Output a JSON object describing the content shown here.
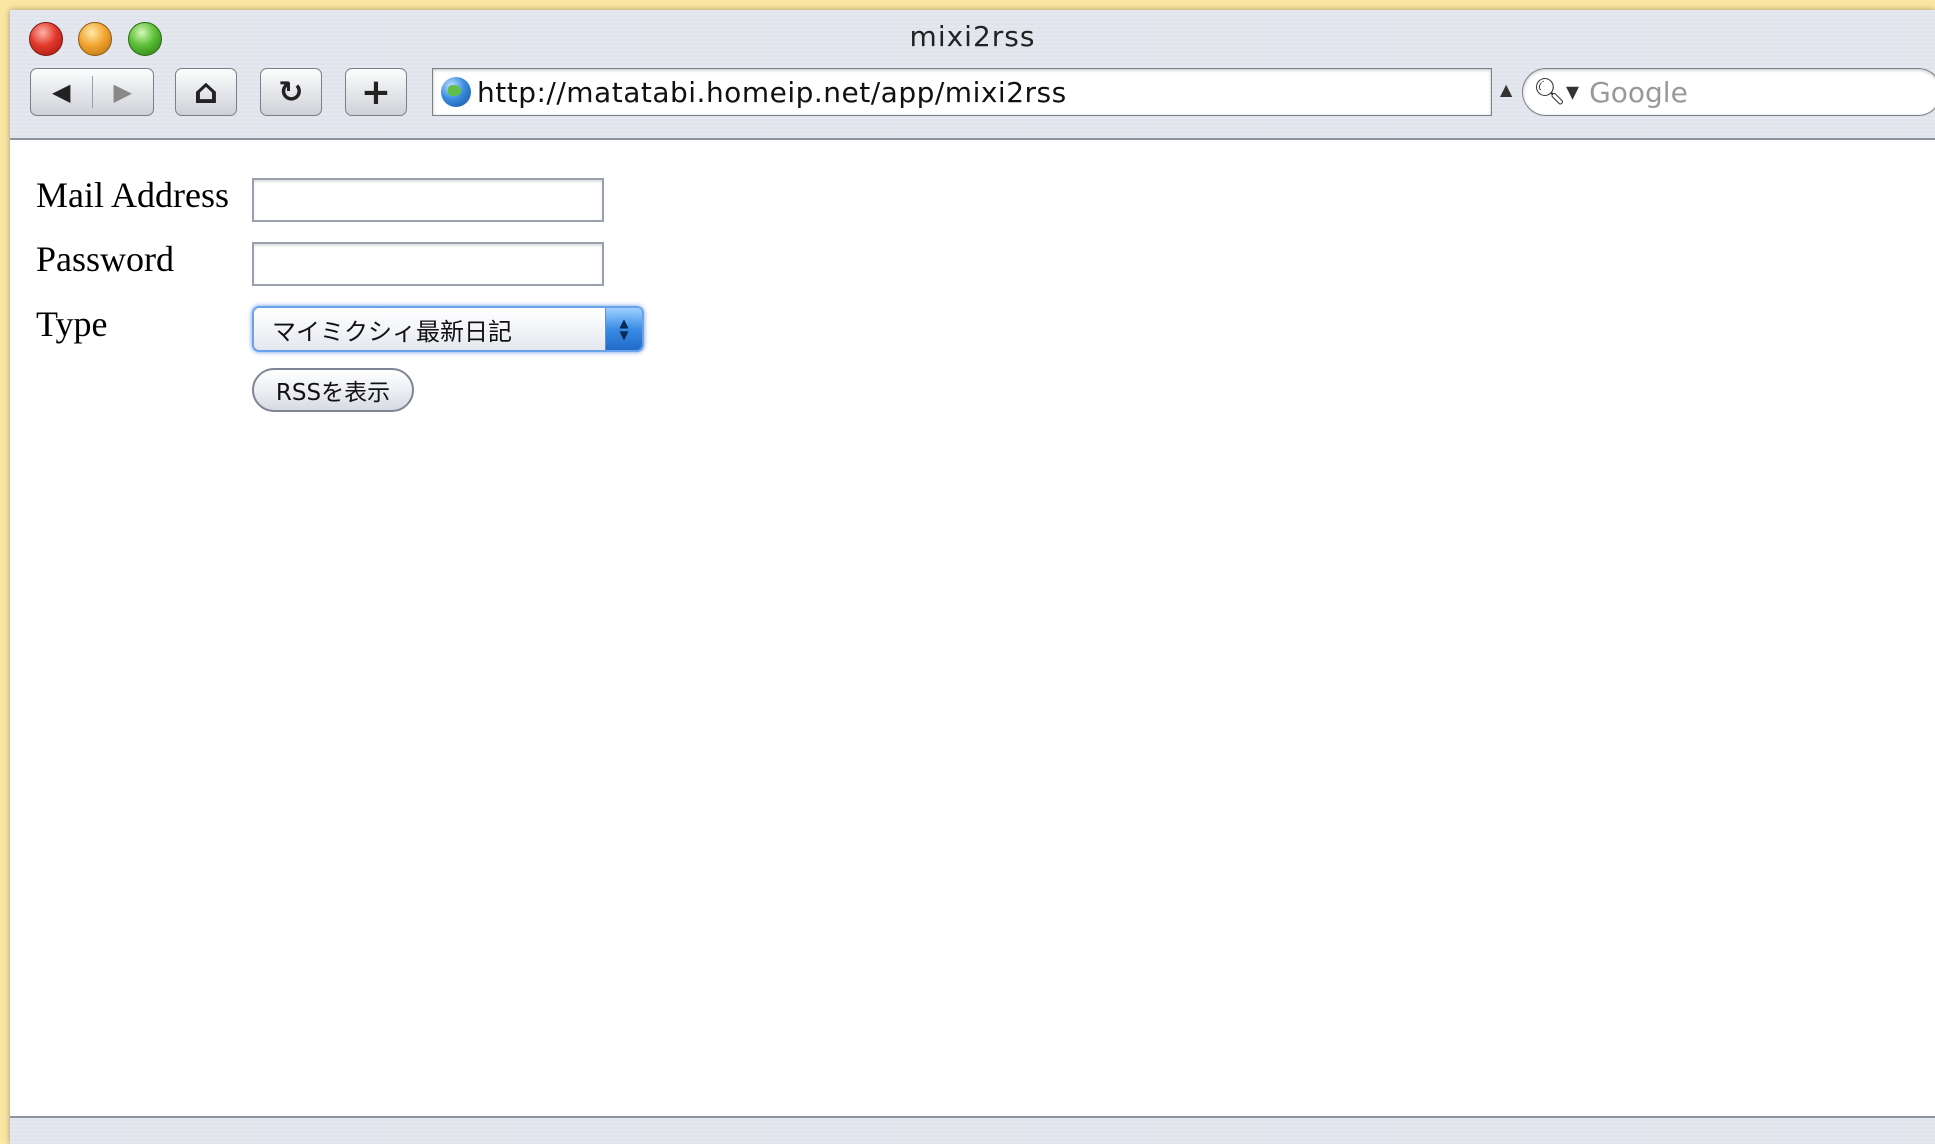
{
  "window": {
    "title": "mixi2rss"
  },
  "toolbar": {
    "back_glyph": "◀",
    "forward_glyph": "▶",
    "home_glyph": "⌂",
    "reload_glyph": "↻",
    "add_glyph": "+",
    "url": "http://matatabi.homeip.net/app/mixi2rss",
    "search_placeholder": "Google",
    "search_icon_glyph": "🔍︎▾"
  },
  "form": {
    "mail_label": "Mail Address",
    "mail_value": "",
    "password_label": "Password",
    "password_value": "",
    "type_label": "Type",
    "type_selected": "マイミクシィ最新日記",
    "submit_label": "RSSを表示"
  },
  "colors": {
    "desktop": "#fbe7a3",
    "select_focus": "#6aa2ec"
  }
}
